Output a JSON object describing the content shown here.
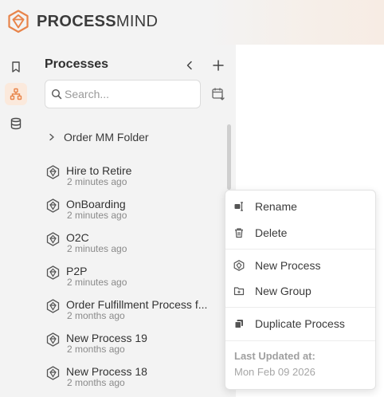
{
  "brand": {
    "name_bold": "PROCESS",
    "name_light": "MIND",
    "accent": "#e8844a"
  },
  "sidebar": {
    "items": [
      {
        "icon": "bookmark-icon",
        "active": false
      },
      {
        "icon": "hierarchy-icon",
        "active": true
      },
      {
        "icon": "database-icon",
        "active": false
      }
    ]
  },
  "panel": {
    "title": "Processes",
    "search_placeholder": "Search...",
    "folder": "Order MM Folder",
    "processes": [
      {
        "name": "Hire to Retire",
        "time": "2 minutes ago"
      },
      {
        "name": "OnBoarding",
        "time": "2 minutes ago"
      },
      {
        "name": "O2C",
        "time": "2 minutes ago"
      },
      {
        "name": "P2P",
        "time": "2 minutes ago"
      },
      {
        "name": "Order Fulfillment Process f...",
        "time": "2 months ago"
      },
      {
        "name": "New Process 19",
        "time": "2 months ago"
      },
      {
        "name": "New Process 18",
        "time": "2 months ago"
      }
    ]
  },
  "context_menu": {
    "rename": "Rename",
    "delete": "Delete",
    "new_process": "New Process",
    "new_group": "New Group",
    "duplicate": "Duplicate Process",
    "last_updated_label": "Last Updated at:",
    "last_updated_value": "Mon Feb 09 2026"
  }
}
